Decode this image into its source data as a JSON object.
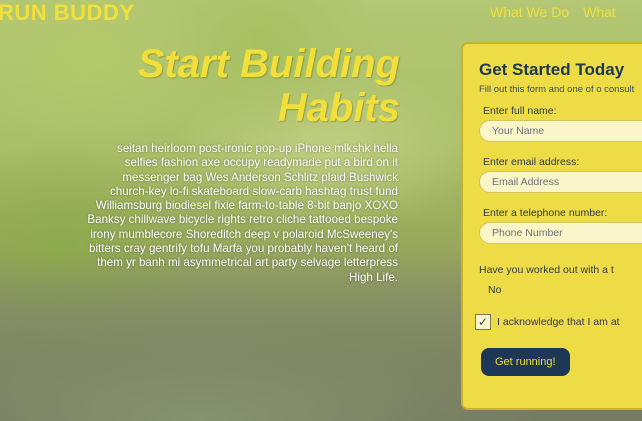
{
  "brand": "RUN BUDDY",
  "nav": [
    "What We Do",
    "What"
  ],
  "hero": {
    "title_line1": "Start Building",
    "title_line2": "Habits",
    "body": "seitan heirloom post-ironic pop-up iPhone mlkshk hella selfies fashion axe occupy readymade put a bird on it messenger bag Wes Anderson Schlitz plaid Bushwick church-key lo-fi skateboard slow-carb hashtag trust fund Williamsburg biodiesel fixie farm-to-table 8-bit banjo XOXO Banksy chillwave bicycle rights retro cliche tattooed bespoke irony mumblecore Shoreditch deep v polaroid McSweeney's bitters cray gentrify tofu Marfa you probably haven't heard of them yr banh mi asymmetrical art party selvage letterpress High Life."
  },
  "form": {
    "title": "Get Started Today",
    "subtitle": "Fill out this form and one of o consult",
    "name_label": "Enter full name:",
    "name_placeholder": "Your Name",
    "email_label": "Enter email address:",
    "email_placeholder": "Email Address",
    "phone_label": "Enter a telephone number:",
    "phone_placeholder": "Phone Number",
    "question": "Have you worked out with a t",
    "question_value": "No",
    "ack_label": "I acknowledge that I am at",
    "ack_checked": "✓",
    "submit_label": "Get running!"
  },
  "colors": {
    "accent": "#f2df3a",
    "form_bg": "#eedc46",
    "button_bg": "#1f3756"
  }
}
